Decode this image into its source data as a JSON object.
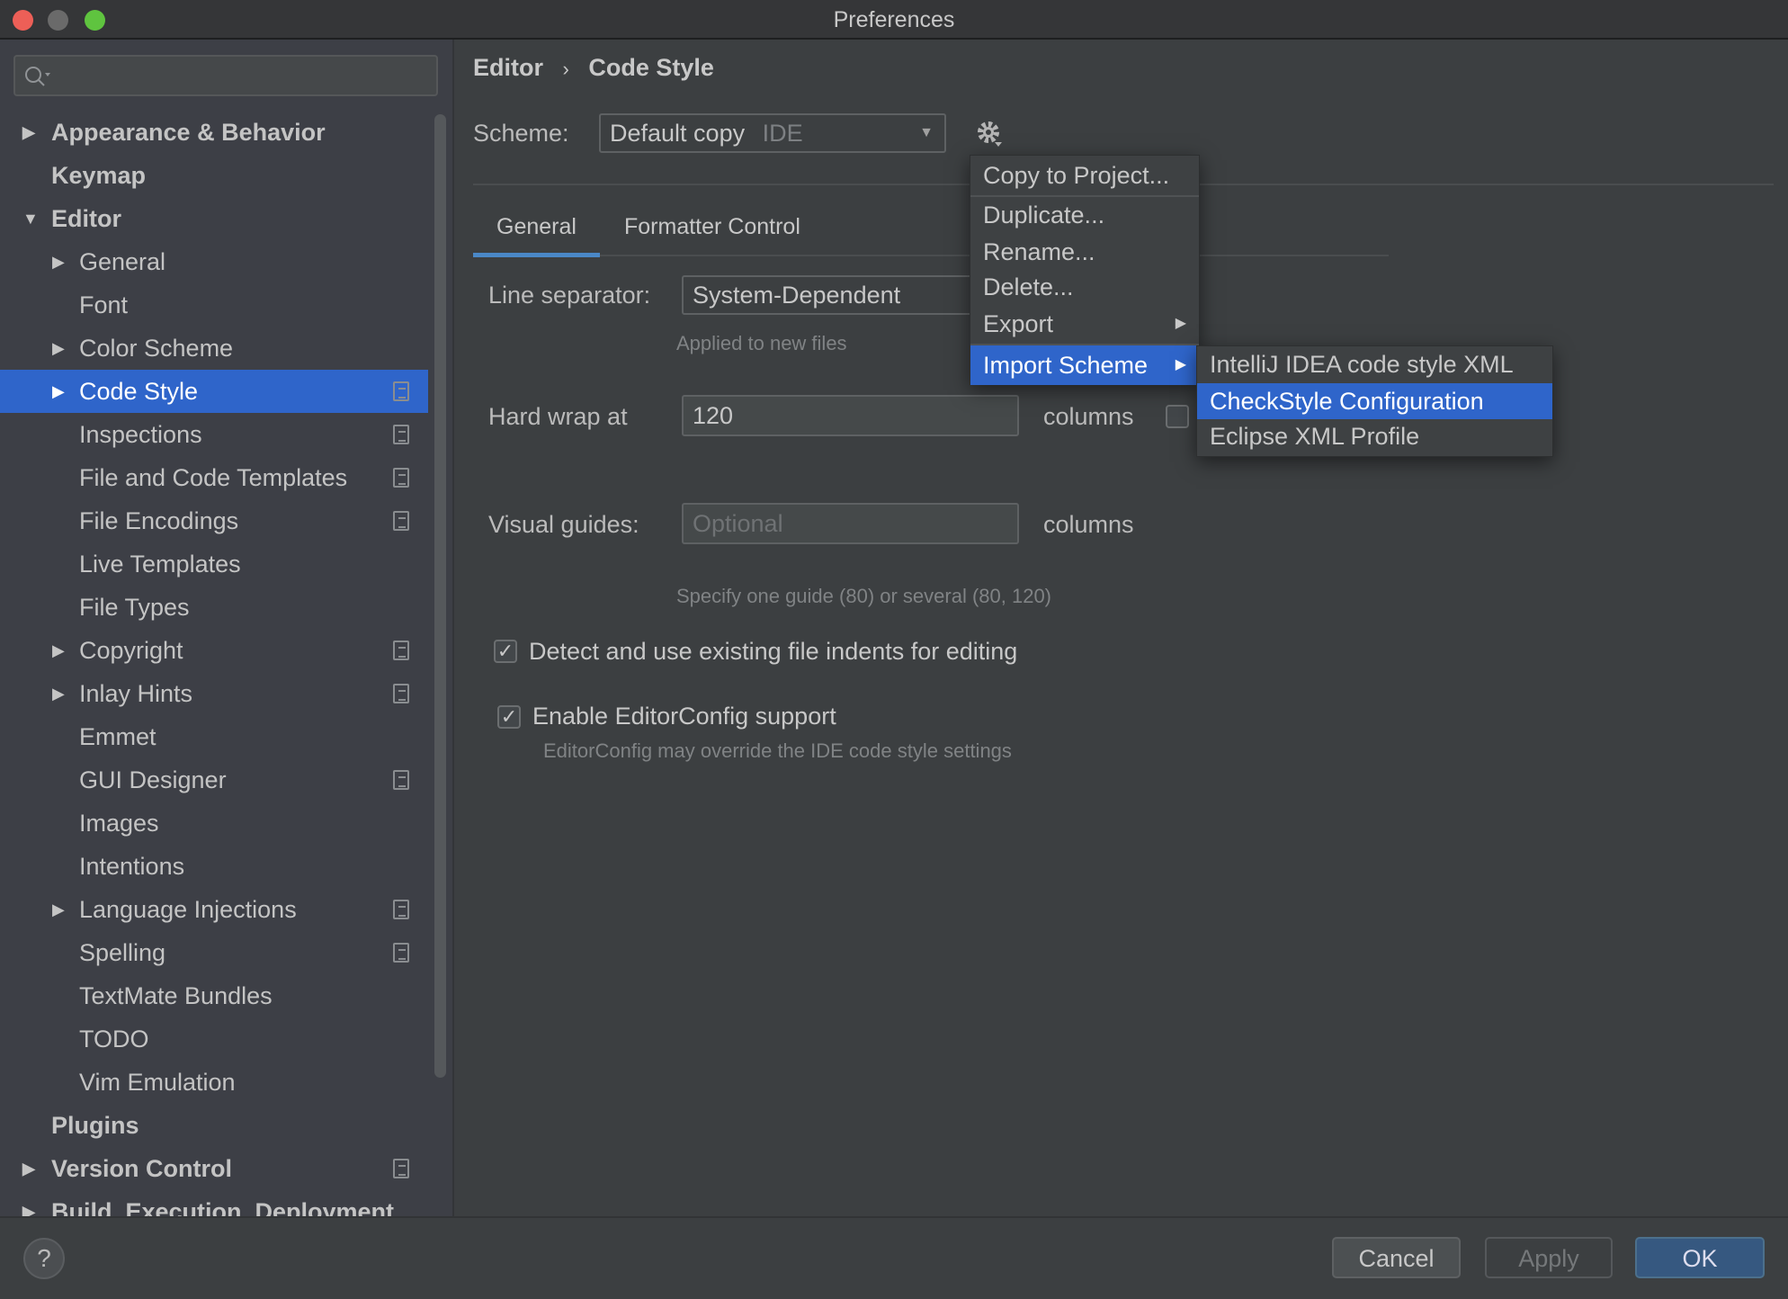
{
  "window": {
    "title": "Preferences",
    "colors": {
      "accent": "#2f65ca",
      "close": "#ed5f57",
      "minimize": "#6a6a6a",
      "maximize": "#5fc43f",
      "ok_button": "#365880"
    }
  },
  "sidebar": {
    "search": {
      "placeholder": "",
      "icon": "search-icon"
    },
    "items": [
      {
        "label": "Appearance & Behavior",
        "level": 0,
        "arrow": "right"
      },
      {
        "label": "Keymap",
        "level": 0
      },
      {
        "label": "Editor",
        "level": 0,
        "arrow": "down"
      },
      {
        "label": "General",
        "level": 1,
        "arrow": "right"
      },
      {
        "label": "Font",
        "level": 1
      },
      {
        "label": "Color Scheme",
        "level": 1,
        "arrow": "right"
      },
      {
        "label": "Code Style",
        "level": 1,
        "arrow": "right",
        "selected": true,
        "project_icon": true
      },
      {
        "label": "Inspections",
        "level": 1,
        "project_icon": true
      },
      {
        "label": "File and Code Templates",
        "level": 1,
        "project_icon": true
      },
      {
        "label": "File Encodings",
        "level": 1,
        "project_icon": true
      },
      {
        "label": "Live Templates",
        "level": 1
      },
      {
        "label": "File Types",
        "level": 1
      },
      {
        "label": "Copyright",
        "level": 1,
        "arrow": "right",
        "project_icon": true
      },
      {
        "label": "Inlay Hints",
        "level": 1,
        "arrow": "right",
        "project_icon": true
      },
      {
        "label": "Emmet",
        "level": 1
      },
      {
        "label": "GUI Designer",
        "level": 1,
        "project_icon": true
      },
      {
        "label": "Images",
        "level": 1
      },
      {
        "label": "Intentions",
        "level": 1
      },
      {
        "label": "Language Injections",
        "level": 1,
        "arrow": "right",
        "project_icon": true
      },
      {
        "label": "Spelling",
        "level": 1,
        "project_icon": true
      },
      {
        "label": "TextMate Bundles",
        "level": 1
      },
      {
        "label": "TODO",
        "level": 1
      },
      {
        "label": "Vim Emulation",
        "level": 1
      },
      {
        "label": "Plugins",
        "level": 0
      },
      {
        "label": "Version Control",
        "level": 0,
        "arrow": "right",
        "project_icon": true
      },
      {
        "label": "Build, Execution, Deployment",
        "level": 0,
        "arrow": "right"
      }
    ]
  },
  "breadcrumb": {
    "parent": "Editor",
    "separator": "›",
    "current": "Code Style"
  },
  "scheme": {
    "label": "Scheme:",
    "value": "Default copy",
    "tag": "IDE"
  },
  "tabs": [
    {
      "label": "General",
      "active": true
    },
    {
      "label": "Formatter Control"
    }
  ],
  "general": {
    "line_separator": {
      "label": "Line separator:",
      "value": "System-Dependent",
      "hint": "Applied to new files"
    },
    "hard_wrap": {
      "label": "Hard wrap at",
      "value": "120",
      "unit": "columns",
      "checked": false
    },
    "visual_guides": {
      "label": "Visual guides:",
      "placeholder": "Optional",
      "unit": "columns",
      "hint": "Specify one guide (80) or several (80, 120)"
    },
    "detect_indents": {
      "label": "Detect and use existing file indents for editing",
      "checked": true
    },
    "editorconfig": {
      "label": "Enable EditorConfig support",
      "checked": true,
      "hint": "EditorConfig may override the IDE code style settings"
    }
  },
  "gear_menu": {
    "items": [
      "Copy to Project...",
      "Duplicate...",
      "Rename...",
      "Delete...",
      "Export",
      "Import Scheme"
    ]
  },
  "import_submenu": {
    "items": [
      "IntelliJ IDEA code style XML",
      "CheckStyle Configuration",
      "Eclipse XML Profile"
    ],
    "highlighted": "CheckStyle Configuration"
  },
  "footer": {
    "help": "?",
    "cancel": "Cancel",
    "apply": "Apply",
    "ok": "OK"
  }
}
